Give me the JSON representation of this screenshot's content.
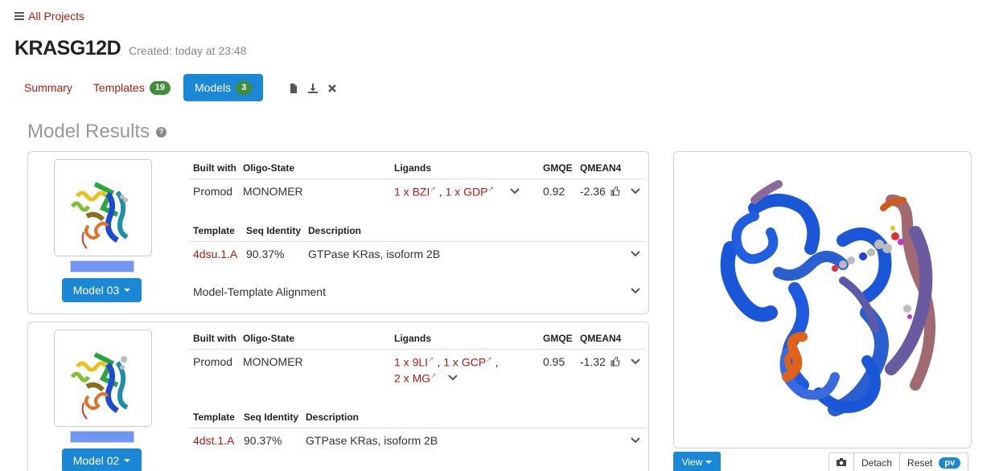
{
  "nav": {
    "all_projects": "All Projects"
  },
  "project": {
    "name": "KRASG12D",
    "created": "Created: today at 23:48"
  },
  "tabs": [
    {
      "label": "Summary"
    },
    {
      "label": "Templates",
      "badge": "19"
    },
    {
      "label": "Models",
      "badge": "3"
    }
  ],
  "section": {
    "title": "Model Results"
  },
  "headers": {
    "built_with": "Built with",
    "oligo": "Oligo-State",
    "ligands": "Ligands",
    "gmqe": "GMQE",
    "qmean": "QMEAN4",
    "template": "Template",
    "seq_identity": "Seq Identity",
    "description": "Description"
  },
  "models": [
    {
      "button": "Model 03",
      "built_with": "Promod",
      "oligo": "MONOMER",
      "ligands_line1": [
        "1 x BZI",
        "1 x GDP"
      ],
      "gmqe": "0.92",
      "qmean": "-2.36",
      "template": "4dsu.1.A",
      "seq_identity": "90.37%",
      "description": "GTPase KRas, isoform 2B",
      "alignment": "Model-Template Alignment"
    },
    {
      "button": "Model 02",
      "built_with": "Promod",
      "oligo": "MONOMER",
      "ligands_line1": [
        "1 x 9LI",
        "1 x GCP"
      ],
      "ligands_line2": "2 x MG",
      "gmqe": "0.95",
      "qmean": "-1.32",
      "template": "4dst.1.A",
      "seq_identity": "90.37%",
      "description": "GTPase KRas, isoform 2B"
    }
  ],
  "viewer": {
    "view_button": "View",
    "detach": "Detach",
    "reset": "Reset",
    "pv": "pv"
  },
  "colors": {
    "link": "#b01b0f",
    "primary": "#1b88d6",
    "badge": "#3f8d3a"
  }
}
